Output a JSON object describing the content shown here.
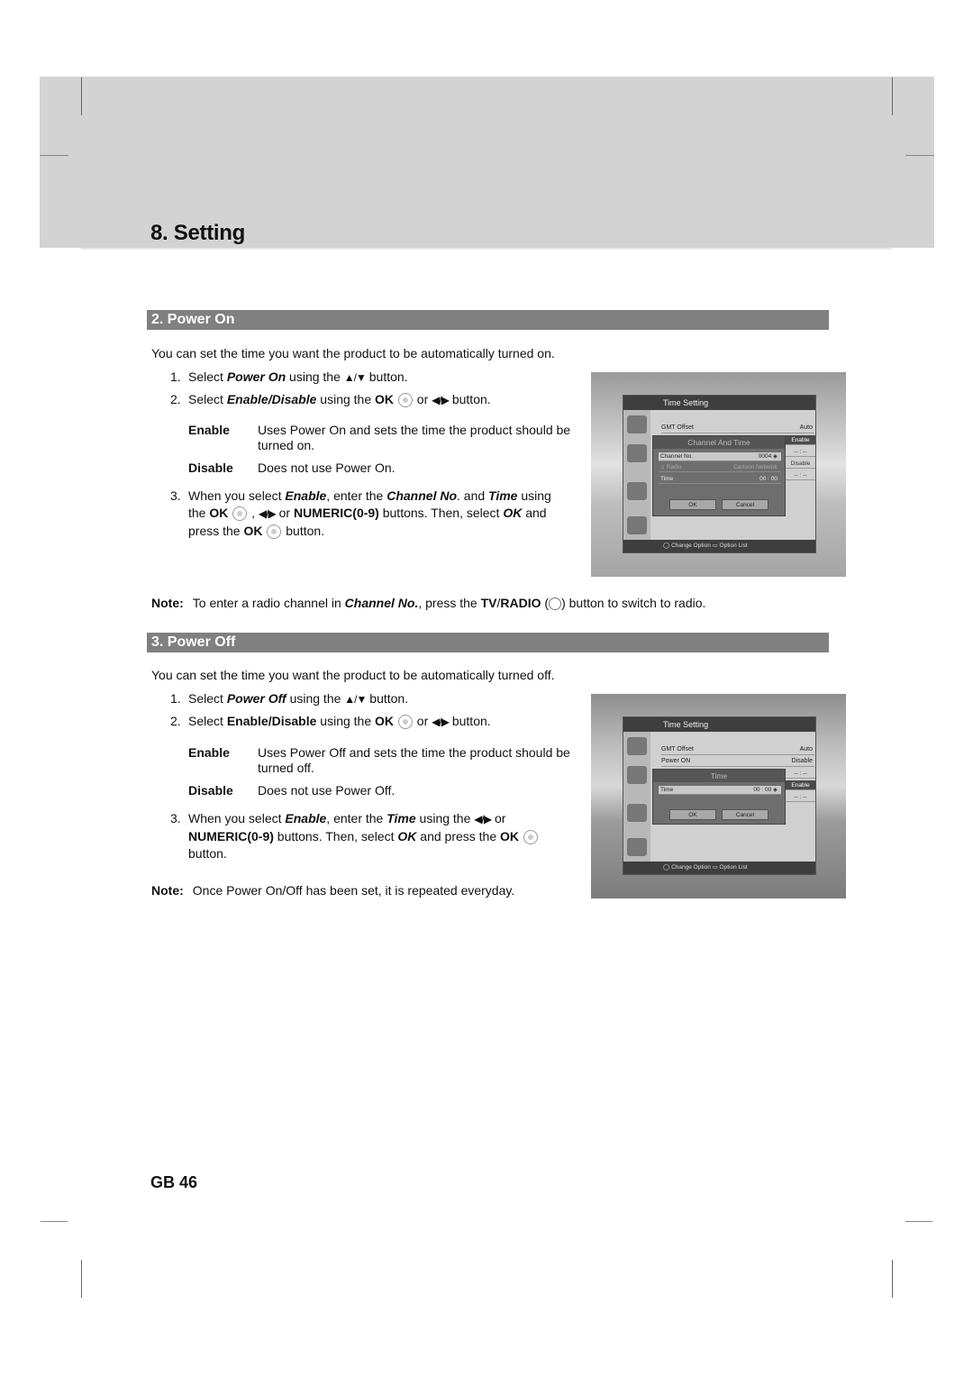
{
  "chapter": {
    "title": "8. Setting"
  },
  "power_on": {
    "heading": "2. Power On",
    "intro": "You can set the time you want the product to be automatically turned on.",
    "step1": {
      "num": "1.",
      "pre": "Select ",
      "em": "Power On",
      "mid": " using the ",
      "icon": "▲/▼",
      "post": " button."
    },
    "step2": {
      "num": "2.",
      "pre": "Select ",
      "em1": "Enable",
      "slash": "/",
      "em2": "Disable",
      "mid": " using the ",
      "ok": "OK",
      "or": " or ",
      "icon": "◀/▶",
      "post": " button."
    },
    "enable": {
      "term": "Enable",
      "desc": "Uses Power On and sets the time the product should be turned on."
    },
    "disable": {
      "term": "Disable",
      "desc": "Does not use Power On."
    },
    "step3": {
      "num": "3.",
      "t1": "When you select ",
      "e1": "Enable",
      "t2": ", enter the ",
      "e2": "Channel No",
      "t3": ". and ",
      "e3": "Time",
      "t4": " using the ",
      "ok1": "OK",
      "comma": " , ",
      "icon": "◀/▶",
      "t5": " or ",
      "numeric": "NUMERIC(0-9)",
      "t6": " buttons. Then, select ",
      "e4": "OK",
      "t7": " and press the ",
      "ok2": "OK",
      "t8": " button."
    },
    "note": {
      "label": "Note:",
      "t1": "To enter a radio channel in ",
      "em": "Channel No.",
      "t2": ", press the ",
      "b1": "TV",
      "slash": "/",
      "b2": "RADIO",
      "t3": " button to switch to radio."
    }
  },
  "power_off": {
    "heading": "3. Power Off",
    "intro": "You can set the time you want the product to be automatically turned off.",
    "step1": {
      "num": "1.",
      "pre": "Select ",
      "em": "Power Off",
      "mid": " using the ",
      "icon": "▲/▼",
      "post": " button."
    },
    "step2": {
      "num": "2.",
      "pre": "Select ",
      "b1": "Enable",
      "slash": "/",
      "b2": "Disable",
      "mid": " using the ",
      "ok": "OK",
      "or": " or ",
      "icon": "◀/▶",
      "post": " button."
    },
    "enable": {
      "term": "Enable",
      "desc": "Uses Power Off and sets the time the product should be turned off."
    },
    "disable": {
      "term": "Disable",
      "desc": "Does not use Power Off."
    },
    "step3": {
      "num": "3.",
      "t1": "When you select ",
      "e1": "Enable",
      "t2": ", enter the ",
      "e2": "Time",
      "t3": " using the ",
      "icon": "◀/▶",
      "t4": " or ",
      "numeric": "NUMERIC(0-9)",
      "t5": " buttons. Then, select ",
      "e3": "OK",
      "t6": " and press the ",
      "ok": "OK",
      "t7": " button."
    },
    "note": {
      "label": "Note:",
      "text": "Once Power On/Off has been set, it is repeated everyday."
    }
  },
  "screen1": {
    "title": "Time Setting",
    "rows": [
      {
        "label": "GMT Offset",
        "value": "Auto"
      }
    ],
    "options": [
      "Enable",
      "-- : --",
      "Disable",
      "-- : --"
    ],
    "dialog": {
      "title": "Channel And Time",
      "rows": [
        {
          "label": "Channel No.",
          "value": "0004 ◈"
        },
        {
          "label": "♫ Radio",
          "value": "Cartoon Network"
        },
        {
          "label": "Time",
          "value": "00 : 00"
        }
      ],
      "ok": "OK",
      "cancel": "Cancel"
    },
    "footer": "◯ Change Option  ▭ Option List"
  },
  "screen2": {
    "title": "Time Setting",
    "rows": [
      {
        "label": "GMT Offset",
        "value": "Auto"
      },
      {
        "label": "Power ON",
        "value": "Disable"
      }
    ],
    "options": [
      "-- : --",
      "Enable",
      "-- : --"
    ],
    "dialog": {
      "title": "Time",
      "rows": [
        {
          "label": "Time",
          "value": "00 : 00 ◈"
        }
      ],
      "ok": "OK",
      "cancel": "Cancel"
    },
    "footer": "◯ Change Option  ▭ Option List"
  },
  "footer": {
    "page": "GB 46"
  }
}
